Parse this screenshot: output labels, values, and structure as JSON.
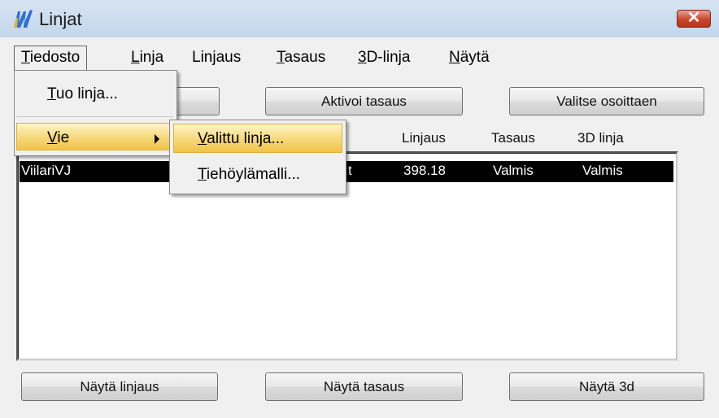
{
  "window": {
    "title": "Linjat",
    "close_label": "✕"
  },
  "menubar": {
    "items": [
      {
        "label_u": "T",
        "label_rest": "iedosto"
      },
      {
        "label_u": "L",
        "label_rest": "inja"
      },
      {
        "label_pre": "Lin",
        "label_u": "j",
        "label_rest": "aus"
      },
      {
        "label_u": "T",
        "label_rest": "asaus"
      },
      {
        "label_u": "3",
        "label_rest": "D-linja"
      },
      {
        "label_u": "N",
        "label_rest": "äytä"
      }
    ]
  },
  "file_menu": {
    "tuo": {
      "label_u": "T",
      "label_rest": "uo linja..."
    },
    "vie": {
      "label_u": "V",
      "label_rest": "ie"
    }
  },
  "vie_submenu": {
    "valittu": {
      "label_u": "V",
      "label_rest": "alittu linja..."
    },
    "tiehoyla": {
      "label_u": "T",
      "label_rest": "iehöylämalli..."
    }
  },
  "top_buttons": {
    "aktivoi": "Aktivoi tasaus",
    "valitse": "Valitse osoittaen"
  },
  "columns": {
    "linjaus": "Linjaus",
    "tasaus": "Tasaus",
    "linja3d": "3D linja"
  },
  "rows": [
    {
      "name": "ViilariVJ",
      "partial": "t",
      "linjaus": "398.18",
      "tasaus": "Valmis",
      "linja3d": "Valmis"
    }
  ],
  "bottom_buttons": {
    "linjaus": "Näytä linjaus",
    "tasaus": "Näytä tasaus",
    "d3": "Näytä 3d"
  },
  "colors": {
    "highlight": "#f6d879",
    "selection": "#000000",
    "close": "#c9452b"
  }
}
